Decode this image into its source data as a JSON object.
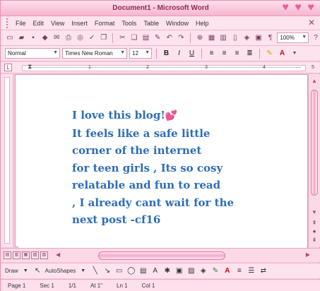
{
  "window": {
    "title": "Document1 - Microsoft Word"
  },
  "menu": [
    "File",
    "Edit",
    "View",
    "Insert",
    "Format",
    "Tools",
    "Table",
    "Window",
    "Help"
  ],
  "toolbar": {
    "zoom": "100%"
  },
  "formatting": {
    "style": "Normal",
    "font": "Times New Roman",
    "size": "12",
    "bold": "B",
    "italic": "I",
    "underline": "U"
  },
  "ruler": {
    "numbers": [
      "1",
      "2",
      "3",
      "4",
      "5"
    ]
  },
  "document": {
    "lines": [
      "I love this blog!",
      "It feels like a safe little",
      "corner of the internet",
      "for teen girls , Its so cosy",
      "relatable and fun to read",
      ", I already cant wait for the",
      "next post -cf16"
    ],
    "text_color": "#2d6db8"
  },
  "drawbar": {
    "draw": "Draw",
    "autoshapes": "AutoShapes"
  },
  "status": {
    "page": "Page 1",
    "sec": "Sec 1",
    "pages": "1/1",
    "at": "At 1\"",
    "ln": "Ln 1",
    "col": "Col 1"
  },
  "colors": {
    "accent": "#f6b5cf",
    "heart": "#ef5c98",
    "text": "#2d6db8"
  }
}
